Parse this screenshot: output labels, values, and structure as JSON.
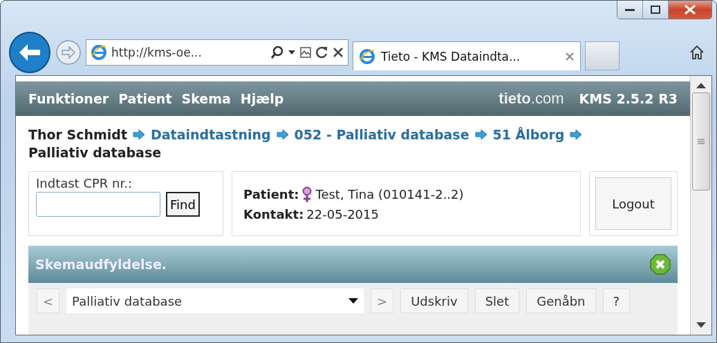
{
  "browser": {
    "address": "http://kms-oe...",
    "tabs": [
      {
        "title": "Tieto - KMS Dataindta...",
        "selected": true
      }
    ]
  },
  "menu": {
    "items": [
      "Funktioner",
      "Patient",
      "Skema",
      "Hjælp"
    ],
    "brand": "**tieto**.com",
    "version": "KMS 2.5.2 R3"
  },
  "breadcrumb": [
    {
      "label": "Thor Schmidt",
      "kind": "text"
    },
    {
      "label": "Dataindtastning",
      "kind": "link"
    },
    {
      "label": "052 - Palliativ database",
      "kind": "link"
    },
    {
      "label": "51 Ålborg",
      "kind": "link"
    },
    {
      "label": "Palliativ database",
      "kind": "text"
    }
  ],
  "cpr": {
    "label": "Indtast CPR nr.:",
    "button": "Find"
  },
  "patient": {
    "label": "Patient:",
    "name": "Test, Tina (010141-2..2)",
    "contact_label": "Kontakt:",
    "contact": "22-05-2015"
  },
  "logout": "Logout",
  "panel": {
    "title": "Skemaudfyldelse.",
    "prev": "<",
    "select": "Palliativ database",
    "next": ">",
    "buttons": [
      "Udskriv",
      "Slet",
      "Genåbn",
      "?"
    ]
  }
}
